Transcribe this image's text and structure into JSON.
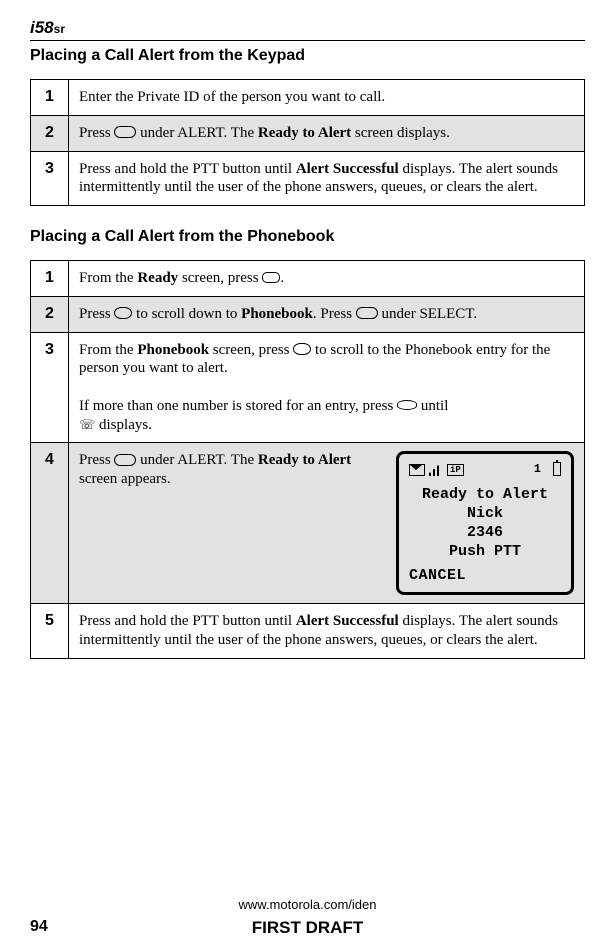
{
  "header": {
    "logo_model": "i58",
    "logo_suffix": "sr"
  },
  "section1": {
    "heading": "Placing a Call Alert from the Keypad",
    "steps": [
      {
        "num": "1",
        "text": "Enter the Private ID of the person you want to call."
      },
      {
        "num": "2",
        "text_a": "Press ",
        "text_b": " under ALERT. The ",
        "bold": "Ready to Alert",
        "text_c": " screen displays."
      },
      {
        "num": "3",
        "text_a": "Press and hold the PTT button until ",
        "bold": "Alert Successful",
        "text_b": " displays. The alert sounds intermittently until the user of the phone answers, queues, or clears the alert."
      }
    ]
  },
  "section2": {
    "heading": "Placing a Call Alert from the Phonebook",
    "steps": [
      {
        "num": "1",
        "text_a": "From the ",
        "bold": "Ready",
        "text_b": " screen, press ",
        "text_c": "."
      },
      {
        "num": "2",
        "text_a": "Press ",
        "text_b": " to scroll down to ",
        "bold": "Phonebook",
        "text_c": ". Press ",
        "text_d": " under SELECT."
      },
      {
        "num": "3",
        "text_a": "From the ",
        "bold": "Phonebook",
        "text_b": " screen, press ",
        "text_c": " to scroll to the Phonebook entry for the person you want to alert.",
        "para2_a": "If more than one number is stored for an entry, press ",
        "para2_b": " until ",
        "para2_c": " displays."
      },
      {
        "num": "4",
        "text_a": "Press ",
        "text_b": " under ALERT. The ",
        "bold": "Ready to Alert",
        "text_c": " screen appears."
      },
      {
        "num": "5",
        "text_a": "Press and hold the PTT button until ",
        "bold": "Alert Successful",
        "text_b": " displays. The alert sounds intermittently until the user of the phone answers, queues, or clears the alert."
      }
    ]
  },
  "screen": {
    "ip": "iP",
    "one": "1",
    "line1": "Ready to Alert",
    "line2": "Nick",
    "line3": "2346",
    "line4": "Push PTT",
    "softkey": "CANCEL"
  },
  "footer": {
    "url": "www.motorola.com/iden",
    "page": "94",
    "draft": "FIRST DRAFT"
  }
}
